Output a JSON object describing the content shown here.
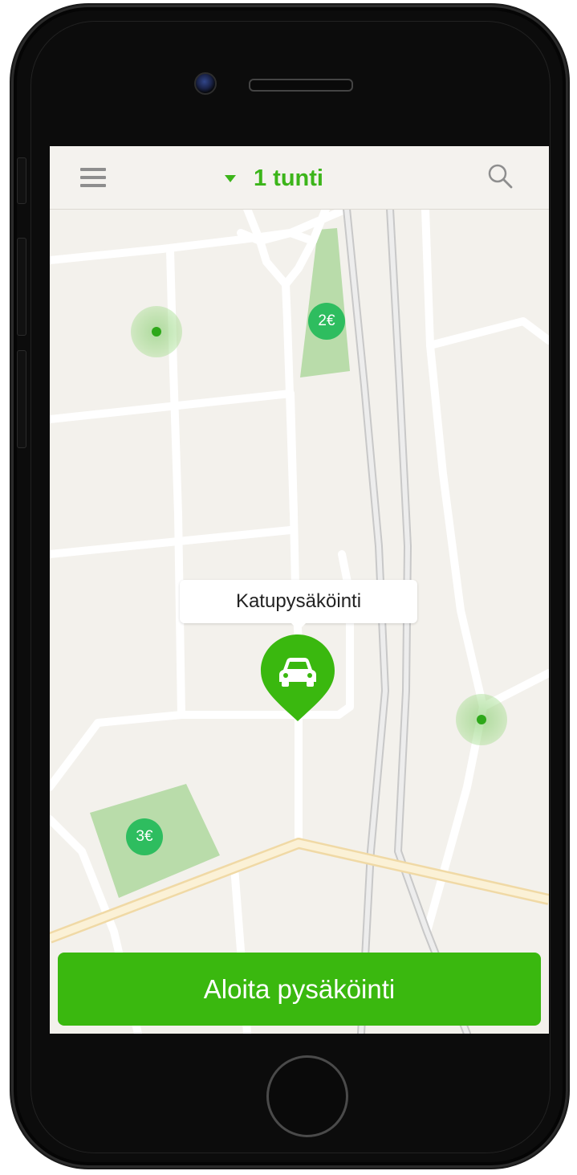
{
  "topbar": {
    "time_label": "1 tunti",
    "menu_icon": "hamburger-menu-icon",
    "caret_icon": "caret-down-icon",
    "search_icon": "search-icon"
  },
  "map": {
    "callout_label": "Katupysäköinti",
    "pin_icon": "car-icon",
    "price_badges": [
      "2€",
      "3€"
    ]
  },
  "actions": {
    "start_button_label": "Aloita pysäköinti"
  },
  "colors": {
    "accent_green": "#3ab80f",
    "title_green": "#3cb51a",
    "badge_green": "#2ebd5f",
    "map_background": "#f3f1ec",
    "parking_zone": "#b9dcaa"
  }
}
